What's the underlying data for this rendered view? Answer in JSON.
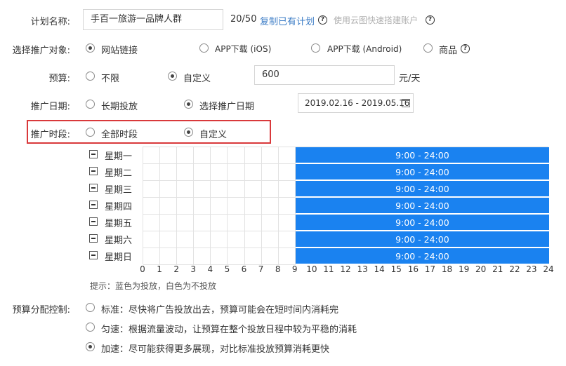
{
  "form": {
    "plan_name": {
      "label": "计划名称:",
      "value": "手百一旅游一品牌人群",
      "counter": "20/50",
      "copy_link": "复制已有计划",
      "help_icon": "question-circle-icon",
      "cloud_map_text": "使用云图快速搭建账户"
    },
    "target": {
      "label": "选择推广对象:",
      "options": [
        "网站链接",
        "APP下载 (iOS)",
        "APP下载 (Android)",
        "商品"
      ],
      "selected_index": 0
    },
    "budget": {
      "label": "预算:",
      "options": [
        "不限",
        "自定义"
      ],
      "selected_index": 1,
      "value": "600",
      "unit": "元/天"
    },
    "date": {
      "label": "推广日期:",
      "options": [
        "长期投放",
        "选择推广日期"
      ],
      "selected_index": 1,
      "range": "2019.02.16 - 2019.05.16",
      "calendar_icon": "calendar-icon"
    },
    "period": {
      "label": "推广时段:",
      "options": [
        "全部时段",
        "自定义"
      ],
      "selected_index": 1
    },
    "schedule": {
      "days": [
        "星期一",
        "星期二",
        "星期三",
        "星期四",
        "星期五",
        "星期六",
        "星期日"
      ],
      "active_text": "9:00 - 24:00",
      "active_start_hour": 9,
      "active_end_hour": 24,
      "hours": [
        "0",
        "1",
        "2",
        "3",
        "4",
        "5",
        "6",
        "7",
        "8",
        "9",
        "10",
        "11",
        "12",
        "13",
        "14",
        "15",
        "16",
        "17",
        "18",
        "19",
        "20",
        "21",
        "22",
        "23",
        "24"
      ],
      "tip": "提示：蓝色为投放，白色为不投放",
      "active_color": "#1a82f0"
    },
    "budget_control": {
      "label": "预算分配控制:",
      "options": [
        "标准：尽快将广告投放出去，预算可能会在短时间内消耗完",
        "匀速：根据流量波动，让预算在整个投放日程中较为平稳的消耗",
        "加速：尽可能获得更多展现，对比标准投放预算消耗更快"
      ],
      "selected_index": 2
    },
    "highlight_color": "#d9393b"
  }
}
